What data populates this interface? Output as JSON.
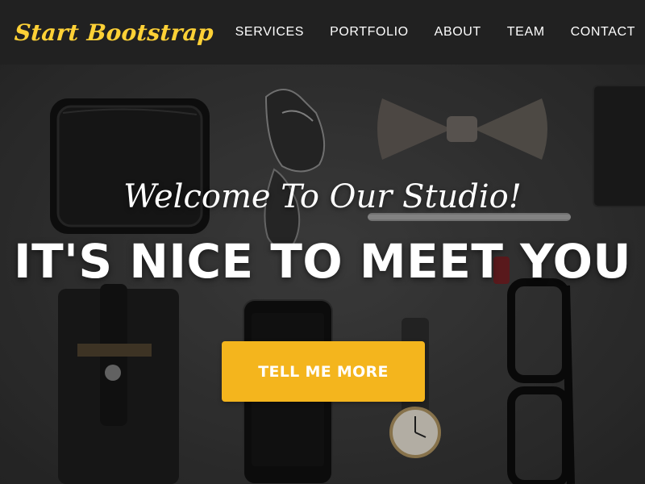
{
  "navbar": {
    "brand": "Start Bootstrap",
    "links": [
      {
        "label": "SERVICES"
      },
      {
        "label": "PORTFOLIO"
      },
      {
        "label": "ABOUT"
      },
      {
        "label": "TEAM"
      },
      {
        "label": "CONTACT"
      }
    ]
  },
  "hero": {
    "lead_in": "Welcome To Our Studio!",
    "heading": "IT'S NICE TO MEET YOU",
    "cta_label": "TELL ME MORE"
  },
  "colors": {
    "brand": "#fed136",
    "button": "#f4b51d",
    "navbar": "#212121"
  }
}
